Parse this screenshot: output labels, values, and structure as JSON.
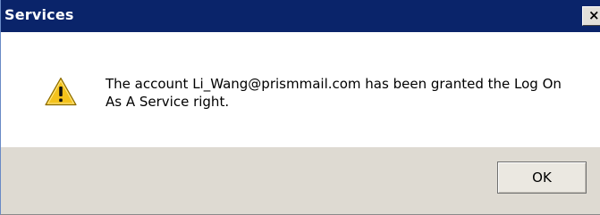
{
  "window": {
    "title": "Services",
    "close_glyph": "✕"
  },
  "message": {
    "icon": "warning-icon",
    "text": "The account Li_Wang@prismmail.com has been granted the Log On As A Service right."
  },
  "buttons": {
    "ok_label": "OK"
  },
  "colors": {
    "titlebar": "#0a246a",
    "footer": "#dedad2",
    "warning_fill": "#f4c21b"
  }
}
